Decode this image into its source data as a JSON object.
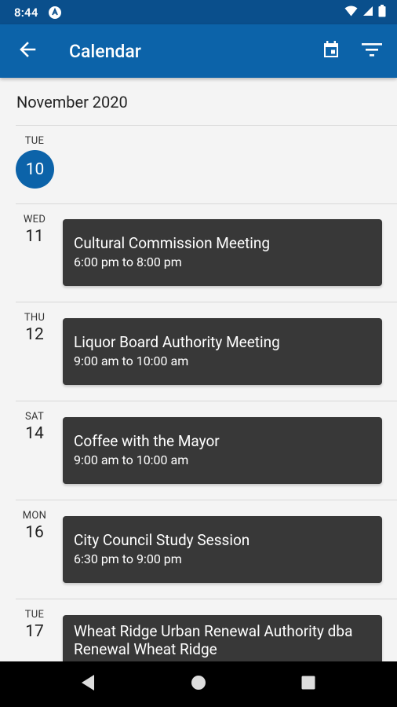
{
  "status_bar": {
    "time": "8:44"
  },
  "app_bar": {
    "title": "Calendar"
  },
  "month": "November 2020",
  "days": [
    {
      "dow": "TUE",
      "date": "10",
      "today": true
    },
    {
      "dow": "WED",
      "date": "11",
      "event": {
        "title": "Cultural Commission Meeting",
        "time": "6:00 pm to 8:00 pm"
      }
    },
    {
      "dow": "THU",
      "date": "12",
      "event": {
        "title": "Liquor Board Authority Meeting",
        "time": "9:00 am to 10:00 am"
      }
    },
    {
      "dow": "SAT",
      "date": "14",
      "event": {
        "title": "Coffee with the Mayor",
        "time": "9:00 am to 10:00 am"
      }
    },
    {
      "dow": "MON",
      "date": "16",
      "event": {
        "title": "City Council Study Session",
        "time": "6:30 pm to 9:00 pm"
      }
    },
    {
      "dow": "TUE",
      "date": "17",
      "event": {
        "title": "Wheat Ridge Urban Renewal Authority dba Renewal Wheat Ridge",
        "time": ""
      }
    }
  ],
  "colors": {
    "status_bar": "#0a4f8c",
    "app_bar": "#0c63a9",
    "today_circle": "#0c63a9",
    "event_card": "#383838",
    "background": "#f4f4f4"
  },
  "icons": [
    "arrow-back-icon",
    "calendar-today-icon",
    "filter-list-icon",
    "nav-back-icon",
    "nav-home-icon",
    "nav-recents-icon"
  ]
}
